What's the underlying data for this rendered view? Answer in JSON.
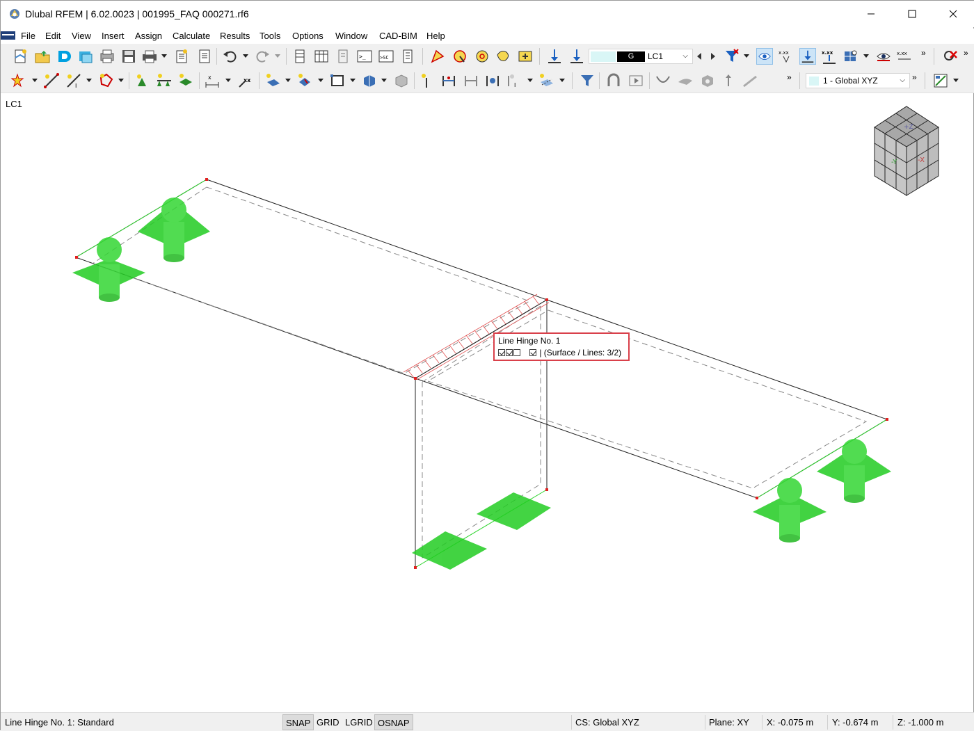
{
  "window": {
    "title": "Dlubal RFEM | 6.02.0023 | 001995_FAQ 000271.rf6"
  },
  "menu": [
    "File",
    "Edit",
    "View",
    "Insert",
    "Assign",
    "Calculate",
    "Results",
    "Tools",
    "Options",
    "Window",
    "CAD-BIM",
    "Help"
  ],
  "toolbar": {
    "load_case_badge": "G",
    "load_case": "LC1",
    "coordinate_system": "1 - Global XYZ"
  },
  "viewport": {
    "load_case_label": "LC1",
    "tooltip": {
      "title": "Line Hinge No. 1",
      "detail": " | (Surface / Lines: 3/2)",
      "checkboxes": [
        true,
        true,
        false,
        null,
        true
      ]
    },
    "support_color": "#22cc22",
    "hinge_color": "#e03030",
    "nav_cube": {
      "top_label": "+Z",
      "left_label": "-Y",
      "right_label": "-X"
    }
  },
  "status": {
    "message": "Line Hinge No. 1: Standard",
    "snap": "SNAP",
    "grid": "GRID",
    "lgrid": "LGRID",
    "osnap": "OSNAP",
    "cs": "CS: Global XYZ",
    "plane": "Plane: XY",
    "x": "X: -0.075 m",
    "y": "Y: -0.674 m",
    "z": "Z: -1.000 m"
  }
}
